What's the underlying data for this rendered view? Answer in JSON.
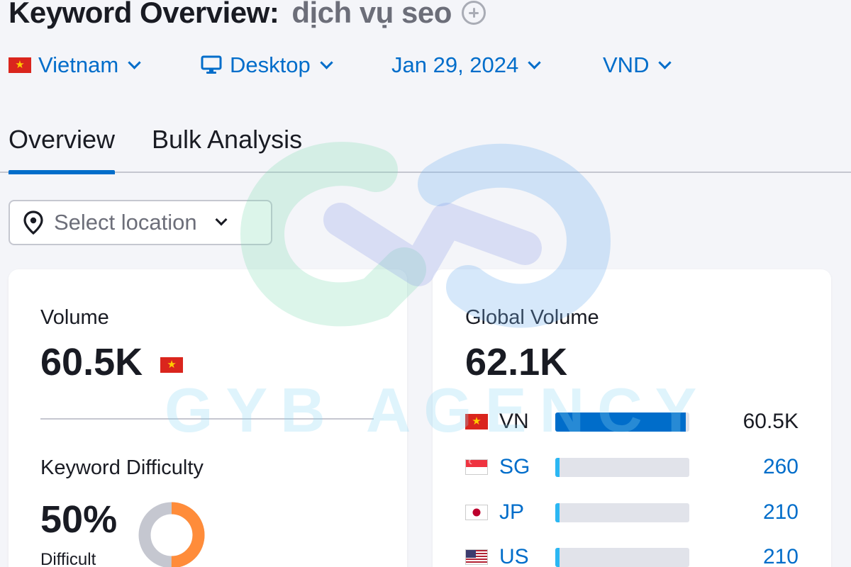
{
  "header": {
    "title": "Keyword Overview:",
    "keyword": "dịch vụ seo"
  },
  "filters": {
    "country": "Vietnam",
    "device": "Desktop",
    "date": "Jan 29, 2024",
    "currency": "VND"
  },
  "tabs": [
    {
      "label": "Overview",
      "active": true
    },
    {
      "label": "Bulk Analysis",
      "active": false
    }
  ],
  "location_select": {
    "placeholder": "Select location"
  },
  "volume_card": {
    "volume_label": "Volume",
    "volume_value": "60.5K",
    "kd_label": "Keyword Difficulty",
    "kd_value": "50%",
    "kd_percent": 50,
    "kd_level": "Difficult"
  },
  "global_card": {
    "label": "Global Volume",
    "value": "62.1K",
    "countries": [
      {
        "code": "VN",
        "value": "60.5K",
        "share": 0.974
      },
      {
        "code": "SG",
        "value": "260",
        "share": 0.004
      },
      {
        "code": "JP",
        "value": "210",
        "share": 0.003
      },
      {
        "code": "US",
        "value": "210",
        "share": 0.003
      }
    ]
  },
  "watermark": {
    "text": "GYB AGENCY"
  },
  "colors": {
    "accent": "#006dca",
    "background": "#f4f5f9",
    "kd_orange": "#ff8c3a",
    "kd_gray": "#c5c7d0"
  }
}
